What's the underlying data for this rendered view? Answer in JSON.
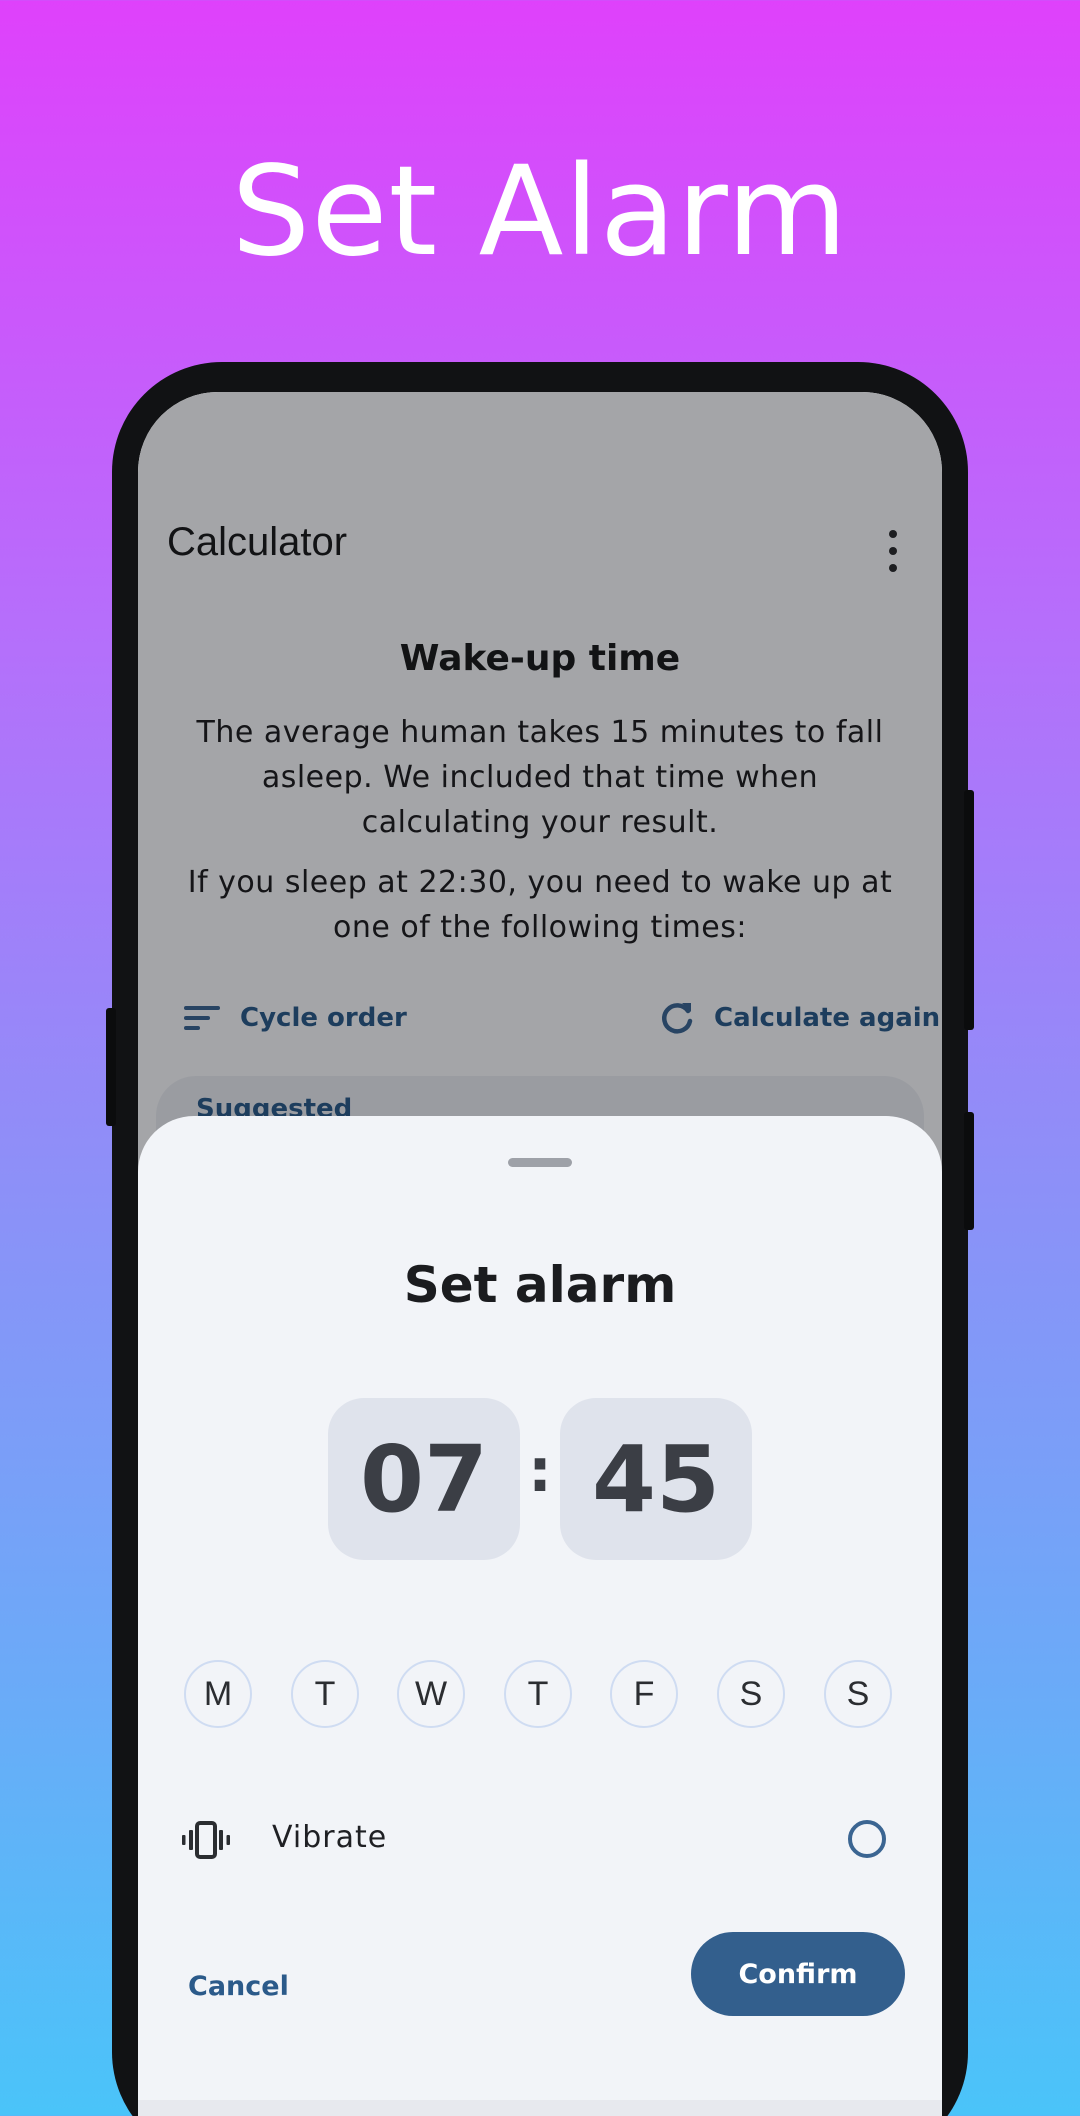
{
  "headline": "Set Alarm",
  "app": {
    "title": "Calculator",
    "result_title": "Wake-up time",
    "paragraph_1": "The average human takes 15 minutes to fall asleep. We included that time when calculating your result.",
    "paragraph_2": "If you sleep at 22:30, you need to wake up at one of the following times:",
    "cycle_order_label": "Cycle order",
    "calculate_again_label": "Calculate again",
    "card_peek_text": "Suggested"
  },
  "sheet": {
    "title": "Set alarm",
    "hour": "07",
    "separator": ":",
    "minute": "45",
    "days": [
      "M",
      "T",
      "W",
      "T",
      "F",
      "S",
      "S"
    ],
    "vibrate_label": "Vibrate",
    "vibrate_checked": false,
    "cancel_label": "Cancel",
    "confirm_label": "Confirm"
  },
  "colors": {
    "gradient_top": "#df41fb",
    "gradient_bottom": "#4ac4f9",
    "accent": "#335f8d",
    "link": "#2b5a8a"
  },
  "icons": {
    "more": "more-vert-icon",
    "sort": "sort-icon",
    "refresh": "refresh-icon",
    "vibrate": "vibrate-icon"
  }
}
